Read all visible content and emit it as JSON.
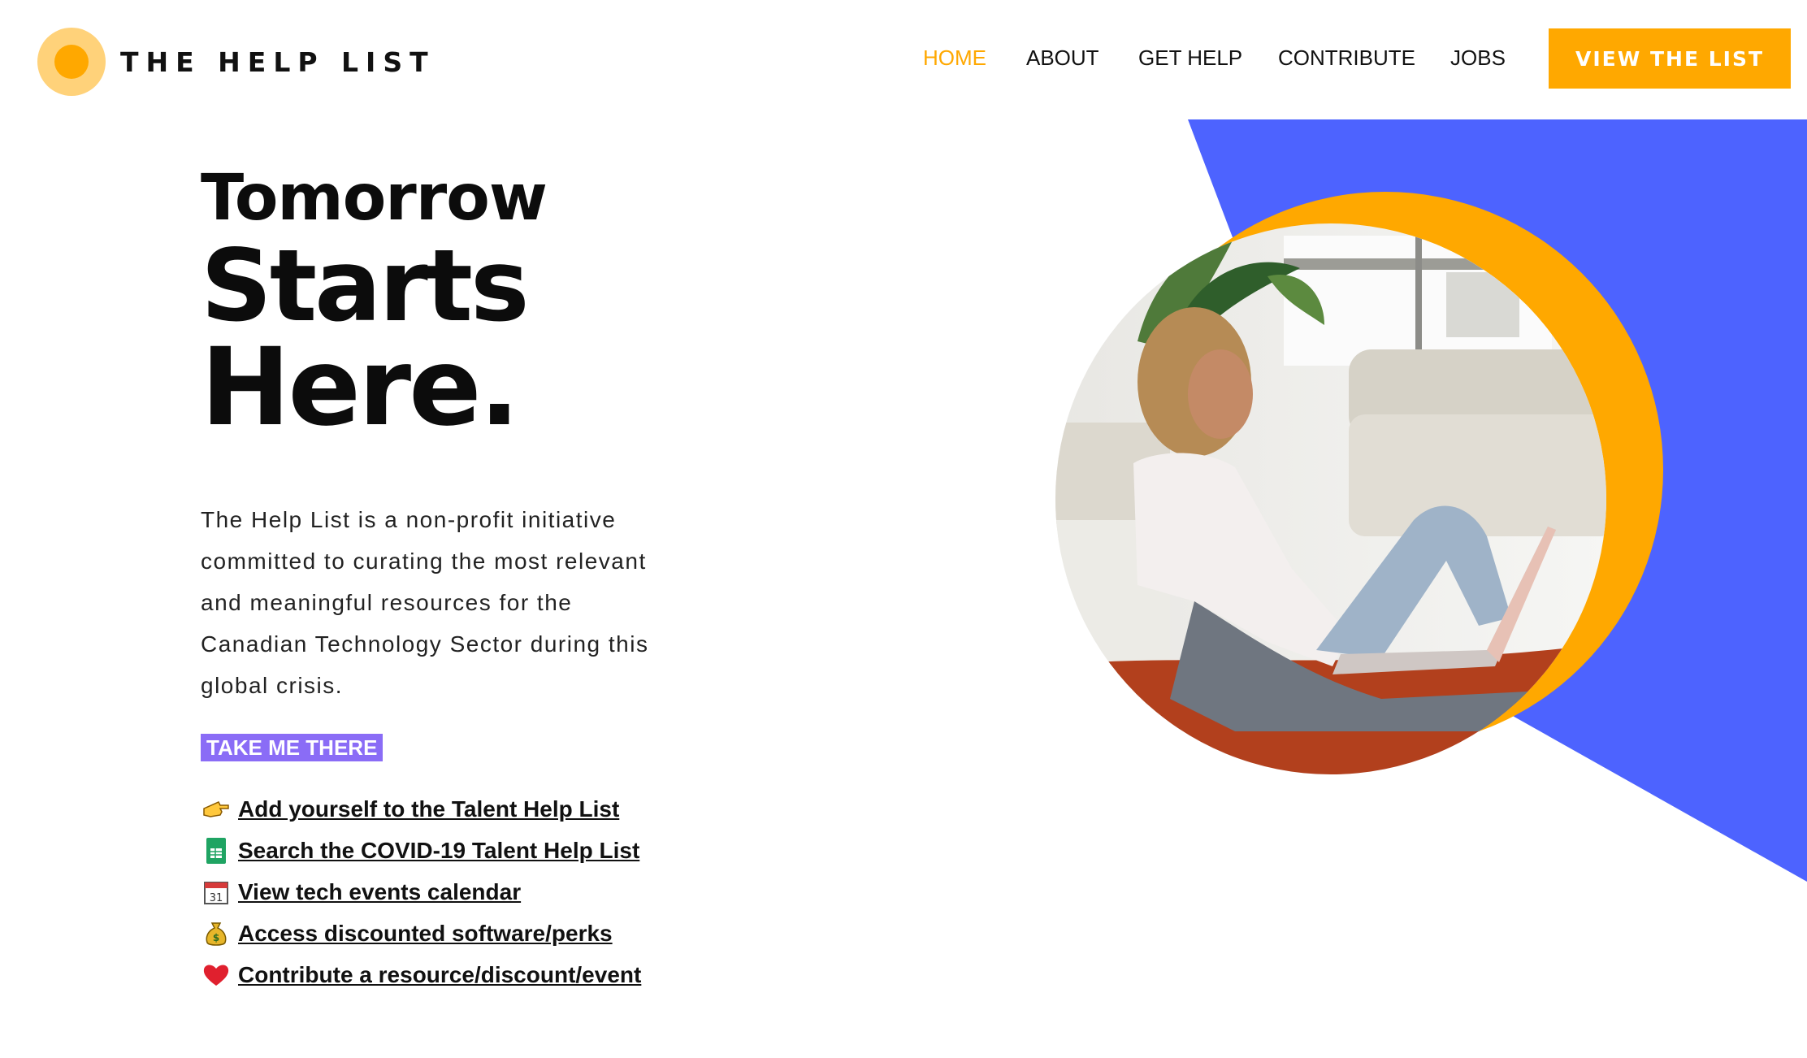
{
  "brand": {
    "name": "THE HELP LIST"
  },
  "nav": {
    "items": [
      {
        "label": "HOME",
        "active": true
      },
      {
        "label": "ABOUT",
        "active": false
      },
      {
        "label": "GET HELP",
        "active": false
      },
      {
        "label": "CONTRIBUTE",
        "active": false
      },
      {
        "label": "JOBS",
        "active": false
      }
    ],
    "cta_label": "VIEW THE LIST"
  },
  "hero": {
    "line1": "Tomorrow",
    "line2": "Starts",
    "line3": "Here.",
    "description": "The Help List is a non-profit initiative committed to curating the most relevant and meaningful resources for the Canadian Technology Sector during this global crisis.",
    "tag": "TAKE ME THERE"
  },
  "links": [
    {
      "icon": "pointing-hand-icon",
      "label": "Add yourself to the Talent Help List"
    },
    {
      "icon": "spreadsheet-icon",
      "label": "Search the COVID-19 Talent Help List"
    },
    {
      "icon": "calendar-icon",
      "label": "View tech events calendar"
    },
    {
      "icon": "money-bag-icon",
      "label": "Access discounted software/perks"
    },
    {
      "icon": "heart-icon",
      "label": "Contribute a resource/discount/event"
    }
  ],
  "colors": {
    "accent": "#ffa800",
    "accent_light": "#ffd27a",
    "blue": "#4d63ff",
    "tag_purple": "#8a6cf6"
  }
}
